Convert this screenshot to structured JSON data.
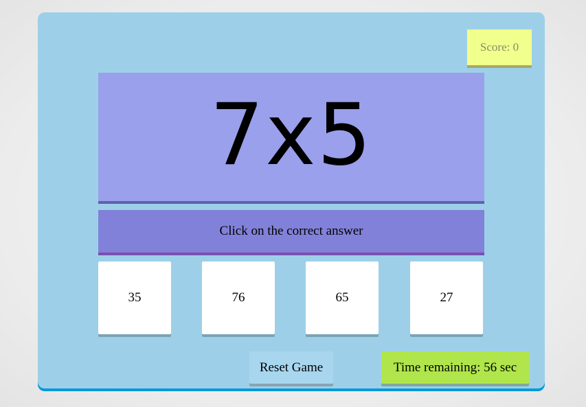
{
  "score": {
    "label": "Score: 0"
  },
  "question": {
    "text": "7x5"
  },
  "instruction": {
    "text": "Click on the correct answer"
  },
  "choices": [
    "35",
    "76",
    "65",
    "27"
  ],
  "controls": {
    "reset_label": "Reset Game",
    "timer_text": "Time remaining: 56 sec"
  },
  "colors": {
    "panel": "#9dd0e8",
    "score_box": "#f1ff8c",
    "question_box": "#9aa0eb",
    "instruction_box": "#8181d9",
    "choice_box": "#ffffff",
    "reset_button": "#a8d6ef",
    "timer_box": "#b0e64b"
  }
}
